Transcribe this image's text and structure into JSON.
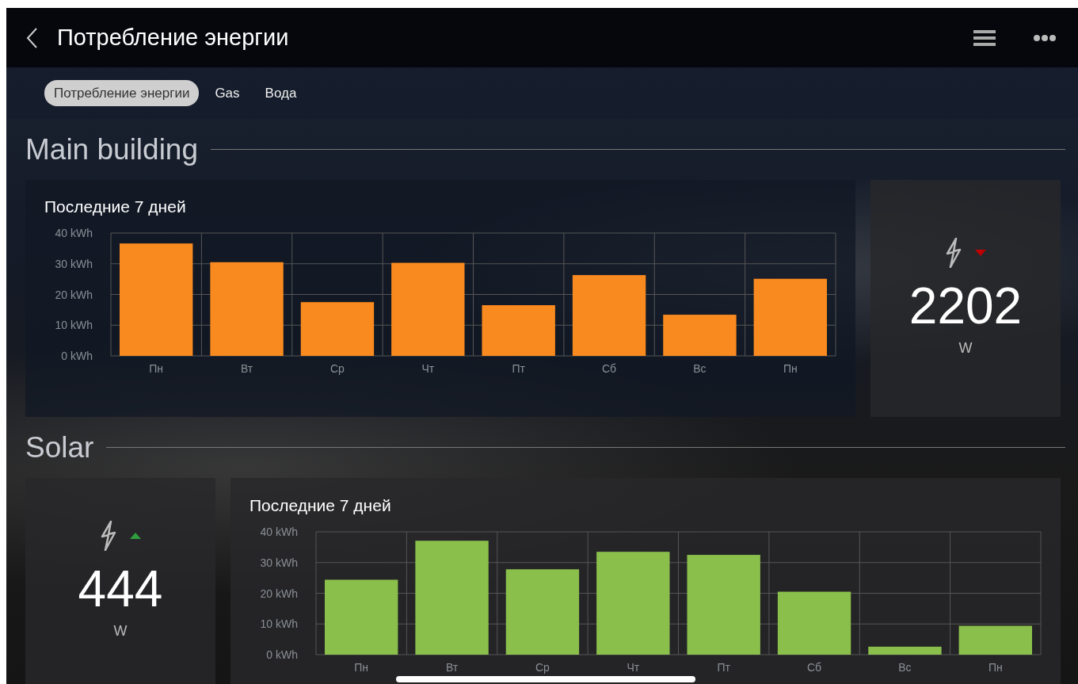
{
  "header": {
    "title": "Потребление энергии"
  },
  "tabs": [
    {
      "label": "Потребление энергии",
      "selected": true
    },
    {
      "label": "Gas",
      "selected": false
    },
    {
      "label": "Вода",
      "selected": false
    }
  ],
  "sections": [
    {
      "title": "Main building",
      "kind": "chart-first",
      "stat": {
        "value": "2202",
        "unit": "W",
        "rising": false
      },
      "chart": {
        "title": "Последние 7 дней",
        "chart_data": {
          "type": "bar",
          "grid": true,
          "categories": [
            "Пн",
            "Вт",
            "Ср",
            "Чт",
            "Пт",
            "Сб",
            "Вс",
            "Пн"
          ],
          "ylim": [
            0,
            40
          ],
          "yticks": [
            {
              "value": 0,
              "label": "0 kWh"
            },
            {
              "value": 10,
              "label": "10 kWh"
            },
            {
              "value": 20,
              "label": "20 kWh"
            },
            {
              "value": 30,
              "label": "30 kWh"
            },
            {
              "value": 40,
              "label": "40 kWh"
            }
          ],
          "series": [
            {
              "color": "#f98a1f",
              "values": [
                36.6,
                30.5,
                17.5,
                30.3,
                16.5,
                26.3,
                13.4,
                25.1
              ]
            }
          ]
        }
      }
    },
    {
      "title": "Solar",
      "kind": "stat-first",
      "stat": {
        "value": "444",
        "unit": "W",
        "rising": true
      },
      "chart": {
        "title": "Последние 7 дней",
        "chart_data": {
          "type": "bar",
          "grid": true,
          "categories": [
            "Пн",
            "Вт",
            "Ср",
            "Чт",
            "Пт",
            "Сб",
            "Вс",
            "Пн"
          ],
          "ylim": [
            0,
            40
          ],
          "yticks": [
            {
              "value": 0,
              "label": "0 kWh"
            },
            {
              "value": 10,
              "label": "10 kWh"
            },
            {
              "value": 20,
              "label": "20 kWh"
            },
            {
              "value": 30,
              "label": "30 kWh"
            },
            {
              "value": 40,
              "label": "40 kWh"
            }
          ],
          "series": [
            {
              "color": "#8bbf4c",
              "values": [
                24.4,
                37.1,
                27.8,
                33.5,
                32.5,
                20.5,
                2.6,
                9.4
              ]
            }
          ]
        }
      }
    }
  ]
}
